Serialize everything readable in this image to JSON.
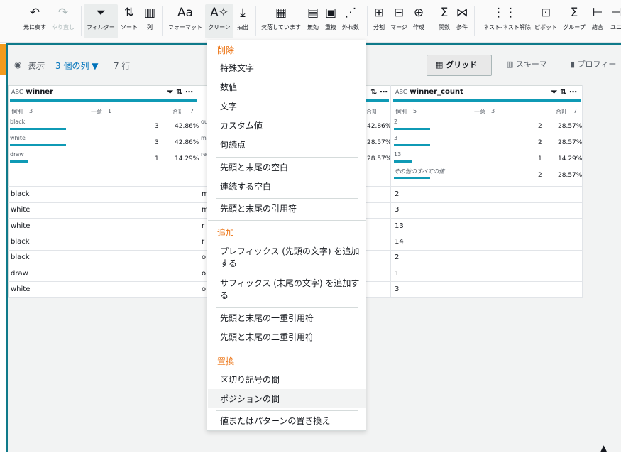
{
  "toolbar": {
    "buttons": [
      {
        "label": "元に戻す",
        "icon": "↶"
      },
      {
        "label": "やり直し",
        "icon": "↷"
      },
      {
        "label": "フィルター",
        "icon": "⏷"
      },
      {
        "label": "ソート",
        "icon": "⇅"
      },
      {
        "label": "列",
        "icon": "▥"
      },
      {
        "label": "フォーマット",
        "icon": "Aa"
      },
      {
        "label": "クリーン",
        "icon": "A✧"
      },
      {
        "label": "抽出",
        "icon": "⤓"
      },
      {
        "label": "欠落しています",
        "icon": "▦"
      },
      {
        "label": "無効",
        "icon": "▤"
      },
      {
        "label": "重複",
        "icon": "▣"
      },
      {
        "label": "外れ数",
        "icon": "⋰"
      },
      {
        "label": "分割",
        "icon": "⊞"
      },
      {
        "label": "マージ",
        "icon": "⊟"
      },
      {
        "label": "作成",
        "icon": "⊕"
      },
      {
        "label": "関数",
        "icon": "Σ"
      },
      {
        "label": "条件",
        "icon": "⋈"
      },
      {
        "label": "ネスト-ネスト解除",
        "icon": "⋮⋮"
      },
      {
        "label": "ピボット",
        "icon": "⊡"
      },
      {
        "label": "グループ",
        "icon": "Σ"
      },
      {
        "label": "結合",
        "icon": "⊢"
      },
      {
        "label": "ユニ",
        "icon": "⊣"
      }
    ]
  },
  "view": {
    "label": "表示",
    "columns": "3 個の列 ▼",
    "rows": "7 行",
    "tabs": [
      "グリッド",
      "スキーマ",
      "プロフィー"
    ]
  },
  "columns": [
    {
      "name": "winner",
      "type": "ABC",
      "distinct_label": "個別",
      "distinct": "3",
      "unique_label": "一意",
      "unique": "1",
      "total_label": "合計",
      "total": "7",
      "profile": [
        {
          "v": "black",
          "n": "3",
          "p": "42.86%"
        },
        {
          "v": "white",
          "n": "3",
          "p": "42.86%"
        },
        {
          "v": "draw",
          "n": "1",
          "p": "14.29%"
        }
      ],
      "rows": [
        "black",
        "white",
        "white",
        "black",
        "black",
        "draw",
        "white"
      ]
    },
    {
      "name": "winner_count",
      "type": "ABC",
      "distinct_label": "個別",
      "distinct": "5",
      "unique_label": "一意",
      "unique": "3",
      "total_label": "合計",
      "total": "7",
      "profile": [
        {
          "v": "2",
          "n": "2",
          "p": "28.57%"
        },
        {
          "v": "3",
          "n": "2",
          "p": "28.57%"
        },
        {
          "v": "13",
          "n": "1",
          "p": "14.29%"
        },
        {
          "v": "その他のすべての値",
          "n": "2",
          "p": "28.57%"
        }
      ],
      "rows": [
        "2",
        "3",
        "13",
        "14",
        "2",
        "1",
        "3"
      ]
    }
  ],
  "mid_partial": {
    "profile_p": [
      "42.86%",
      "28.57%",
      "28.57%"
    ],
    "rows": [
      "m",
      "m",
      "r",
      "r",
      "o",
      "o",
      "o"
    ]
  },
  "menu": {
    "sections": [
      {
        "header": "削除",
        "items": [
          "特殊文字",
          "数値",
          "文字",
          "カスタム値",
          "句読点",
          "先頭と末尾の空白",
          "連続する空白",
          "先頭と末尾の引用符"
        ]
      },
      {
        "header": "追加",
        "items": [
          "プレフィックス (先頭の文字) を追加する",
          "サフィックス (末尾の文字) を追加する",
          "先頭と末尾の一重引用符",
          "先頭と末尾の二重引用符"
        ]
      },
      {
        "header": "置換",
        "items": [
          "区切り記号の間",
          "ポジションの間",
          "値またはパターンの置き換え"
        ]
      }
    ]
  }
}
